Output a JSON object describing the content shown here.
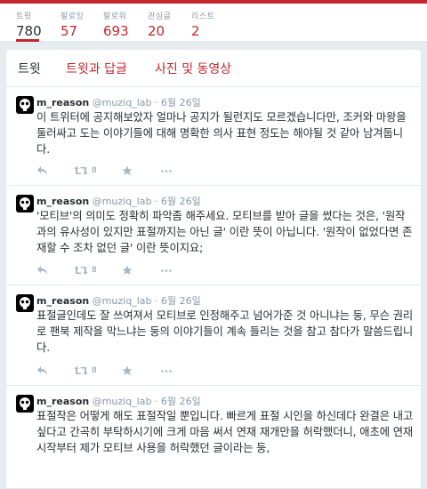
{
  "profile_nav": [
    {
      "label": "트윗",
      "value": "780"
    },
    {
      "label": "팔로잉",
      "value": "57"
    },
    {
      "label": "팔로워",
      "value": "693"
    },
    {
      "label": "관심글",
      "value": "20"
    },
    {
      "label": "리스트",
      "value": "2"
    }
  ],
  "tabs": [
    {
      "label": "트윗"
    },
    {
      "label": "트윗과 답글"
    },
    {
      "label": "사진 및 동영상"
    }
  ],
  "colors": {
    "accent": "#c1272d",
    "text": "#292f33",
    "muted": "#8899a6",
    "border": "#e1e8ed"
  },
  "tweets": [
    {
      "name": "m_reason",
      "handle": "@muziq_lab",
      "time": "· 6월 26일",
      "text": "이 트위터에 공지해보았자 얼마나 공지가 될런지도 모르겠습니다만, 조커와 마왕을 둘러싸고 도는 이야기들에 대해 명확한 의사 표현 정도는 해야될 것 같아 남겨둡니다.",
      "retweets": "8"
    },
    {
      "name": "m_reason",
      "handle": "@muziq_lab",
      "time": "· 6월 26일",
      "text": "'모티브'의 의미도 정확히 파악좀 해주세요. 모티브를 받아 글을 썼다는 것은, '원작과의 유사성이 있지만 표절까지는 아닌 글' 이란 뜻이 아닙니다. '원작이 없었다면 존재할 수 조차 없던 글' 이란 뜻이지요;",
      "retweets": "8"
    },
    {
      "name": "m_reason",
      "handle": "@muziq_lab",
      "time": "· 6월 26일",
      "text": "표절글인데도 잘 쓰여져서 모티브로 인정해주고 넘어가준 것 아니냐는 둥, 무슨 권리로 팬북 제작을 막느냐는 둥의 이야기들이 계속 들리는 것을 참고 참다가 말씀드립니다.",
      "retweets": "8"
    },
    {
      "name": "m_reason",
      "handle": "@muziq_lab",
      "time": "· 6월 26일",
      "text": "표절작은 어떻게 해도 표절작일 뿐입니다. 빠르게 표절 시인을 하신데다 완결은 내고 싶다고 간곡히 부탁하시기에 크게 마음 써서 연재 재개만을 허락했더니, 애초에 연재 시작부터 제가 모티브 사용을 허락했던 글이라는 둥,"
    }
  ]
}
